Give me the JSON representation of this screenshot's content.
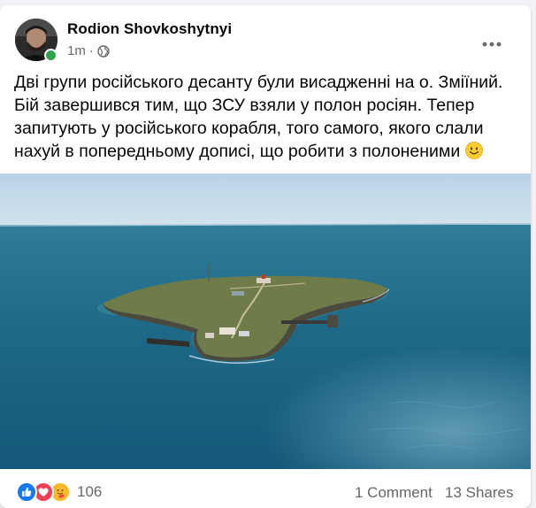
{
  "post": {
    "author_name": "Rodion Shovkoshytnyi",
    "timestamp": "1m",
    "separator": "·",
    "privacy_icon": "globe-icon",
    "more_icon": "more-options-icon",
    "text": "Дві групи російського десанту були висадженні на о. Зміїний. Бій завершився тим, що ЗСУ взяли у полон росіян. Тепер  запитують у російського корабля, того самого, якого слали нахуй в попередньому дописі, що робити з полоненими",
    "text_emoji": "smiling-face-icon",
    "photo": "aerial-island-photo"
  },
  "footer": {
    "reaction_icons": [
      "like-icon",
      "love-icon",
      "care-icon"
    ],
    "reaction_count": "106",
    "comments_label": "1 Comment",
    "shares_label": "13 Shares"
  },
  "colors": {
    "page_bg": "#f0f2f5",
    "card_bg": "#ffffff",
    "primary_text": "#050505",
    "secondary_text": "#65676b",
    "online_green": "#31a24c",
    "like_blue": "#1877f2",
    "love_red": "#f33e58",
    "care_yellow": "#f7b928"
  }
}
